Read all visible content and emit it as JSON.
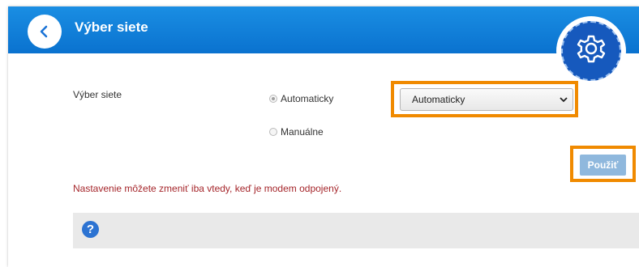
{
  "header": {
    "title": "Výber siete"
  },
  "form": {
    "field_label": "Výber siete",
    "options": [
      {
        "label": "Automaticky",
        "checked": true
      },
      {
        "label": "Manuálne",
        "checked": false
      }
    ],
    "select_value": "Automaticky",
    "apply_label": "Použiť"
  },
  "warning": "Nastavenie môžete zmeniť iba vtedy, keď je modem odpojený.",
  "help": {
    "icon": "?"
  },
  "colors": {
    "header": "#0a72cf",
    "highlight": "#f08a00",
    "warning": "#a5262b",
    "apply_button": "#8fb8dd"
  }
}
